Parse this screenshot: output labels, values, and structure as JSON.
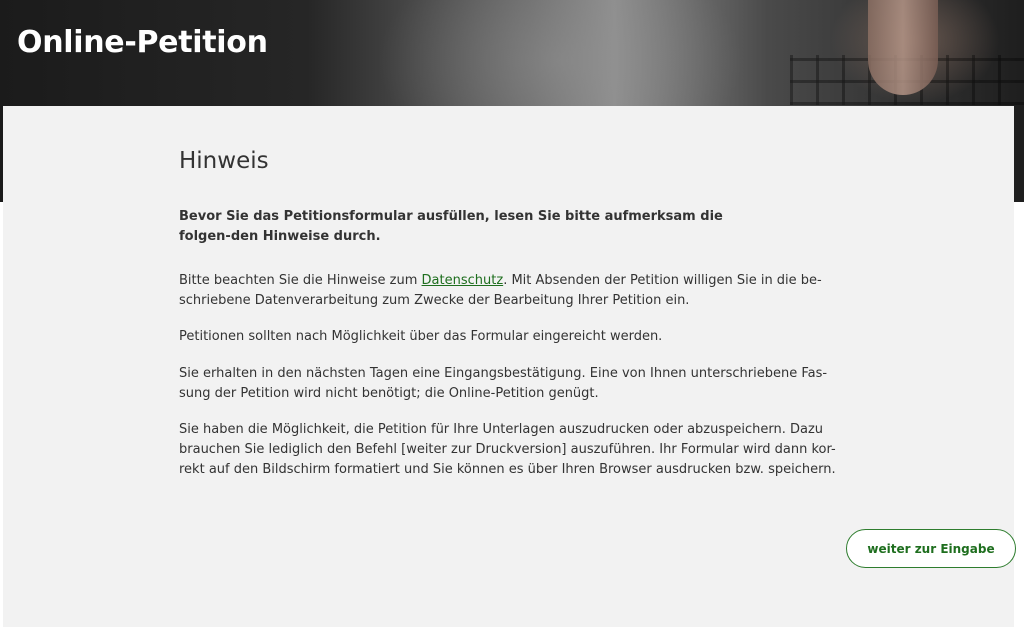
{
  "header": {
    "title": "Online-Petition"
  },
  "notice": {
    "heading": "Hinweis",
    "lead": "Bevor Sie das Petitionsformular ausfüllen, lesen Sie bitte aufmerksam die folgen-den Hinweise durch.",
    "privacy_before": "Bitte beachten Sie die Hinweise zum ",
    "privacy_link": "Datenschutz",
    "privacy_after": ". Mit Absenden der Petition willigen Sie in die be-schriebene Datenverarbeitung zum Zwecke der Bearbeitung Ihrer Petition ein.",
    "form_note": "Petitionen sollten nach Möglichkeit über das Formular eingereicht werden.",
    "confirmation": "Sie erhalten in den nächsten Tagen eine Eingangsbestätigung. Eine von Ihnen unterschriebene Fas-sung der Petition wird nicht benötigt; die Online-Petition genügt.",
    "print_note": "Sie haben die Möglichkeit, die Petition für Ihre Unterlagen auszudrucken oder abzuspeichern. Dazu brauchen Sie lediglich den Befehl [weiter zur Druckversion] auszuführen. Ihr Formular wird dann kor-rekt auf den Bildschirm formatiert und Sie können es über Ihren Browser ausdrucken bzw. speichern."
  },
  "actions": {
    "continue_label": "weiter zur Eingabe"
  },
  "colors": {
    "accent": "#1e6e1e",
    "panel_background": "#f2f2f2"
  }
}
